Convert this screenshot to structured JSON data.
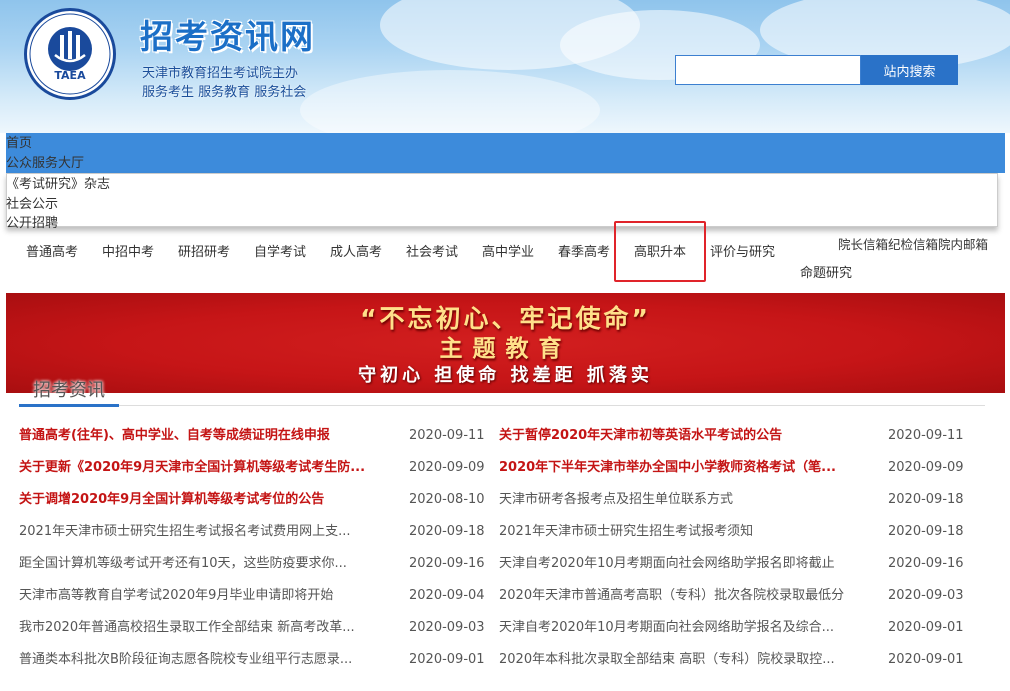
{
  "header": {
    "logo_abbr": "TAEA",
    "site_title": "招考资讯网",
    "subtitle": "天津市教育招生考试院主办",
    "slogan": "服务考生 服务教育 服务社会"
  },
  "search": {
    "placeholder": "",
    "button_label": "站内搜索"
  },
  "quick_links": [
    "首页",
    "公众服务大厅",
    "《考试研究》杂志",
    "社会公示",
    "公开招聘"
  ],
  "top_right": "院长信箱纪检信箱院内邮箱",
  "nav": [
    "普通高考",
    "中招中考",
    "研招研考",
    "自学考试",
    "成人高考",
    "社会考试",
    "高中学业",
    "春季高考",
    "高职升本",
    "评价与研究",
    "命题研究"
  ],
  "banner": {
    "title": "“不忘初心、牢记使命”",
    "subtitle": "主题教育",
    "slogan": "守初心 担使命 找差距 抓落实"
  },
  "section_title": "招考资讯",
  "news_left": [
    {
      "title": "普通高考(往年)、高中学业、自考等成绩证明在线申报",
      "date": "2020-09-11",
      "style": "red"
    },
    {
      "title": "关于更新《2020年9月天津市全国计算机等级考试考生防...",
      "date": "2020-09-09",
      "style": "red"
    },
    {
      "title": "关于调增2020年9月全国计算机等级考试考位的公告",
      "date": "2020-08-10",
      "style": "red"
    },
    {
      "title": "2021年天津市硕士研究生招生考试报名考试费用网上支...",
      "date": "2020-09-18",
      "style": "normal"
    },
    {
      "title": "距全国计算机等级考试开考还有10天，这些防疫要求你...",
      "date": "2020-09-16",
      "style": "normal"
    },
    {
      "title": "天津市高等教育自学考试2020年9月毕业申请即将开始",
      "date": "2020-09-04",
      "style": "normal"
    },
    {
      "title": "我市2020年普通高校招生录取工作全部结束 新高考改革...",
      "date": "2020-09-03",
      "style": "normal"
    },
    {
      "title": "普通类本科批次B阶段征询志愿各院校专业组平行志愿录...",
      "date": "2020-09-01",
      "style": "normal"
    }
  ],
  "news_right": [
    {
      "title": "关于暂停2020年天津市初等英语水平考试的公告",
      "date": "2020-09-11",
      "style": "red"
    },
    {
      "title": "2020年下半年天津市举办全国中小学教师资格考试（笔...",
      "date": "2020-09-09",
      "style": "red"
    },
    {
      "title": "天津市研考各报考点及招生单位联系方式",
      "date": "2020-09-18",
      "style": "normal"
    },
    {
      "title": "2021年天津市硕士研究生招生考试报考须知",
      "date": "2020-09-18",
      "style": "normal"
    },
    {
      "title": "天津自考2020年10月考期面向社会网络助学报名即将截止",
      "date": "2020-09-16",
      "style": "normal"
    },
    {
      "title": "2020年天津市普通高考高职（专科）批次各院校录取最低分",
      "date": "2020-09-03",
      "style": "normal"
    },
    {
      "title": "天津自考2020年10月考期面向社会网络助学报名及综合...",
      "date": "2020-09-01",
      "style": "normal"
    },
    {
      "title": "2020年本科批次录取全部结束 高职（专科）院校录取控...",
      "date": "2020-09-01",
      "style": "normal"
    }
  ],
  "colors": {
    "accent": "#2a72c8",
    "nav_bar": "#3d8bdb",
    "banner": "#c61517",
    "highlight": "#e0242a"
  }
}
